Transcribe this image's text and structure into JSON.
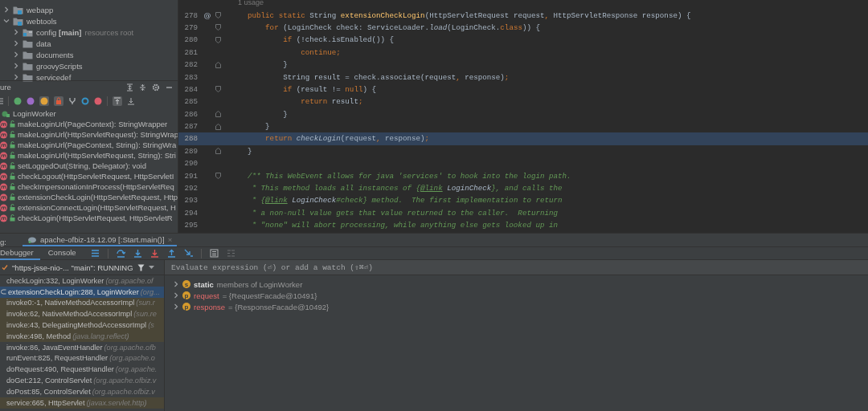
{
  "project_tree": [
    {
      "label": "webapp",
      "kind": "module",
      "expanded": false
    },
    {
      "label": "webtools",
      "kind": "module",
      "expanded": true,
      "children": [
        {
          "label": "config **[main]**",
          "hint": "resources root",
          "kind": "source-root",
          "expanded": false
        },
        {
          "label": "data",
          "kind": "folder",
          "expanded": false
        },
        {
          "label": "documents",
          "kind": "folder",
          "expanded": false
        },
        {
          "label": "groovyScripts",
          "kind": "folder",
          "expanded": false
        },
        {
          "label": "servicedef",
          "kind": "folder",
          "expanded": false
        }
      ]
    }
  ],
  "structure": {
    "title": "ure",
    "class_name": "LoginWorker",
    "members": [
      "makeLoginUrl(PageContext): StringWrapper",
      "makeLoginUrl(HttpServletRequest): StringWrap",
      "makeLoginUrl(PageContext, String): StringWra",
      "makeLoginUrl(HttpServletRequest, String): Stri",
      "setLoggedOut(String, Delegator): void",
      "checkLogout(HttpServletRequest, HttpServletI",
      "checkImpersonationInProcess(HttpServletReq",
      "extensionCheckLogin(HttpServletRequest, Http",
      "extensionConnectLogin(HttpServletRequest, H",
      "checkLogin(HttpServletRequest, HttpServletR"
    ]
  },
  "editor": {
    "usage": "1 usage",
    "lines": [
      {
        "number": "278",
        "marker": "@",
        "kind": "opener",
        "highlighted": false,
        "segments": [
          {
            "text": "    public static ",
            "kind": "kw"
          },
          {
            "text": "String ",
            "kind": "plain"
          },
          {
            "text": "extensionCheckLogin",
            "kind": "decl"
          },
          {
            "text": "(HttpServletRequest request",
            "kind": "plain"
          },
          {
            "text": ", ",
            "kind": "kw"
          },
          {
            "text": "HttpServletResponse response) {",
            "kind": "plain"
          }
        ]
      },
      {
        "number": "279",
        "kind": "opener",
        "highlighted": false,
        "segments": [
          {
            "text": "        for ",
            "kind": "kw"
          },
          {
            "text": "(LoginCheck check: ServiceLoader.",
            "kind": "plain"
          },
          {
            "text": "load",
            "kind": "italic"
          },
          {
            "text": "(LoginCheck.",
            "kind": "plain"
          },
          {
            "text": "class",
            "kind": "kw"
          },
          {
            "text": ")) {",
            "kind": "plain"
          }
        ]
      },
      {
        "number": "280",
        "kind": "opener",
        "highlighted": false,
        "segments": [
          {
            "text": "            if ",
            "kind": "kw"
          },
          {
            "text": "(!check.isEnabled()) {",
            "kind": "plain"
          }
        ]
      },
      {
        "number": "281",
        "highlighted": false,
        "segments": [
          {
            "text": "                continue;",
            "kind": "kw"
          }
        ]
      },
      {
        "number": "282",
        "kind": "closer",
        "highlighted": false,
        "segments": [
          {
            "text": "            }",
            "kind": "plain"
          }
        ]
      },
      {
        "number": "283",
        "highlighted": false,
        "segments": [
          {
            "text": "            String result = check.associate(request",
            "kind": "plain"
          },
          {
            "text": ", ",
            "kind": "kw"
          },
          {
            "text": "response)",
            "kind": "plain"
          },
          {
            "text": ";",
            "kind": "kw"
          }
        ]
      },
      {
        "number": "284",
        "kind": "opener",
        "highlighted": false,
        "segments": [
          {
            "text": "            if ",
            "kind": "kw"
          },
          {
            "text": "(result != ",
            "kind": "plain"
          },
          {
            "text": "null",
            "kind": "kw"
          },
          {
            "text": ") {",
            "kind": "plain"
          }
        ]
      },
      {
        "number": "285",
        "highlighted": false,
        "segments": [
          {
            "text": "                return ",
            "kind": "kw"
          },
          {
            "text": "result",
            "kind": "plain"
          },
          {
            "text": ";",
            "kind": "kw"
          }
        ]
      },
      {
        "number": "286",
        "kind": "closer",
        "highlighted": false,
        "segments": [
          {
            "text": "            }",
            "kind": "plain"
          }
        ]
      },
      {
        "number": "287",
        "kind": "closer",
        "highlighted": false,
        "segments": [
          {
            "text": "        }",
            "kind": "plain"
          }
        ]
      },
      {
        "number": "288",
        "highlighted": true,
        "segments": [
          {
            "text": "        return ",
            "kind": "kw"
          },
          {
            "text": "checkLogin",
            "kind": "italic"
          },
          {
            "text": "(request",
            "kind": "plain"
          },
          {
            "text": ", ",
            "kind": "kw"
          },
          {
            "text": "response)",
            "kind": "plain"
          },
          {
            "text": ";",
            "kind": "kw"
          }
        ]
      },
      {
        "number": "289",
        "kind": "closer",
        "highlighted": false,
        "segments": [
          {
            "text": "    }",
            "kind": "plain"
          }
        ]
      },
      {
        "number": "290",
        "highlighted": false
      },
      {
        "number": "291",
        "kind": "opener",
        "highlighted": false,
        "segments": [
          {
            "text": "    /** This WebEvent allows for java 'services' to hook into the login path.",
            "kind": "comment"
          }
        ]
      },
      {
        "number": "292",
        "highlighted": false,
        "segments": [
          {
            "text": "     * This method loads all instances of {",
            "kind": "comment"
          },
          {
            "text": "@link",
            "kind": "tag"
          },
          {
            "text": " LoginCheck",
            "kind": "ref"
          },
          {
            "text": "}, and calls the",
            "kind": "comment"
          }
        ]
      },
      {
        "number": "293",
        "highlighted": false,
        "segments": [
          {
            "text": "     * {",
            "kind": "comment"
          },
          {
            "text": "@link",
            "kind": "tag"
          },
          {
            "text": " LoginCheck",
            "kind": "ref"
          },
          {
            "text": "#check} method.  The first implementation to return",
            "kind": "comment"
          }
        ]
      },
      {
        "number": "294",
        "highlighted": false,
        "segments": [
          {
            "text": "     * a non-null value gets that value returned to the caller.  Returning",
            "kind": "comment"
          }
        ]
      },
      {
        "number": "295",
        "highlighted": false,
        "segments": [
          {
            "text": "     * \"none\" will abort processing, while anything else gets looked up in",
            "kind": "comment"
          }
        ]
      }
    ]
  },
  "debug": {
    "title": "g:",
    "session": "apache-ofbiz-18.12.09 [:Start.main()]",
    "close": "×",
    "tabs": [
      {
        "label": "Debugger",
        "selected": true
      },
      {
        "label": "Console",
        "selected": false
      }
    ],
    "thread": "\"https-jsse-nio-... \"main\": RUNNING",
    "frames": [
      {
        "method": "checkLogin:332, LoginWorker",
        "package": "(org.apache.of",
        "kind": "app",
        "selected": false
      },
      {
        "method": "extensionCheckLogin:288, LoginWorker",
        "package": "(org...",
        "kind": "app",
        "selected": true
      },
      {
        "method": "invoke0:-1, NativeMethodAccessorImpl",
        "package": "(sun.r",
        "kind": "library",
        "selected": false
      },
      {
        "method": "invoke:62, NativeMethodAccessorImpl",
        "package": "(sun.re",
        "kind": "library",
        "selected": false
      },
      {
        "method": "invoke:43, DelegatingMethodAccessorImpl",
        "package": "(s",
        "kind": "library",
        "selected": false
      },
      {
        "method": "invoke:498, Method",
        "package": "(java.lang.reflect)",
        "kind": "library",
        "selected": false
      },
      {
        "method": "invoke:86, JavaEventHandler",
        "package": "(org.apache.ofb",
        "kind": "app",
        "selected": false
      },
      {
        "method": "runEvent:825, RequestHandler",
        "package": "(org.apache.o",
        "kind": "app",
        "selected": false
      },
      {
        "method": "doRequest:490, RequestHandler",
        "package": "(org.apache.",
        "kind": "app",
        "selected": false
      },
      {
        "method": "doGet:212, ControlServlet",
        "package": "(org.apache.ofbiz.v",
        "kind": "app",
        "selected": false
      },
      {
        "method": "doPost:85, ControlServlet",
        "package": "(org.apache.ofbiz.v",
        "kind": "app",
        "selected": false
      },
      {
        "method": "service:665, HttpServlet",
        "package": "(javax.servlet.http)",
        "kind": "library",
        "selected": false
      }
    ],
    "evaluate": {
      "placeholder": "Evaluate expression (⏎) or add a watch (⇧⌘⏎)"
    },
    "variables": [
      {
        "badge": "s",
        "name": "static",
        "value": "members of LoginWorker",
        "kind": "static"
      },
      {
        "badge": "p",
        "name": "request",
        "value": "= {RequestFacade@10491}",
        "kind": "param"
      },
      {
        "badge": "p",
        "name": "response",
        "value": "= {ResponseFacade@10492}",
        "kind": "param"
      }
    ]
  }
}
